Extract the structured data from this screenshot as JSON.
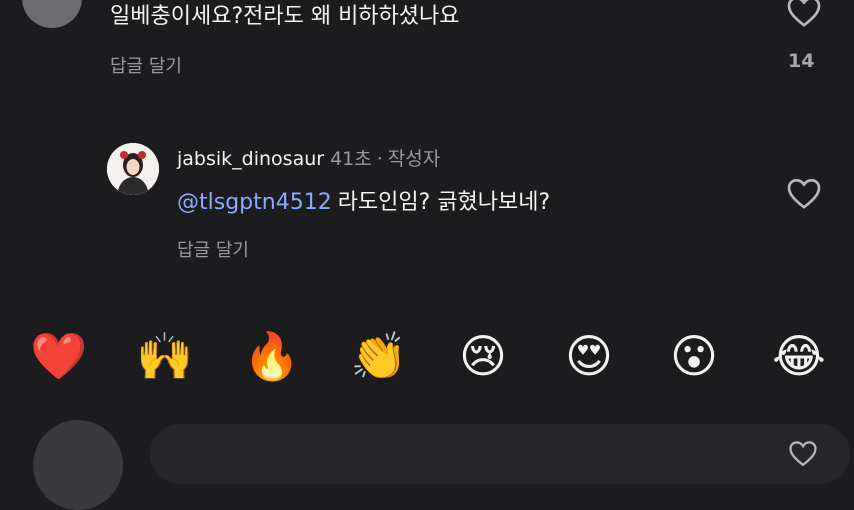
{
  "comment1": {
    "text": "일베충이세요?전라도 왜 비하하셨나요",
    "reply_label": "답글 달기",
    "like_count": "14"
  },
  "comment2": {
    "username": "jabsik_dinosaur",
    "time": "41초",
    "separator": "·",
    "author_badge": "작성자",
    "mention": "@tlsgptn4512",
    "text": "라도인임? 긁혔나보네?",
    "reply_label": "답글 달기"
  },
  "emoji_bar": [
    "❤️",
    "🙌",
    "🔥",
    "👏",
    "😢",
    "😍",
    "😮",
    "😂"
  ],
  "colors": {
    "background": "#1c1c1e",
    "mention": "#8fa7ff",
    "muted": "#9a9a9e"
  }
}
